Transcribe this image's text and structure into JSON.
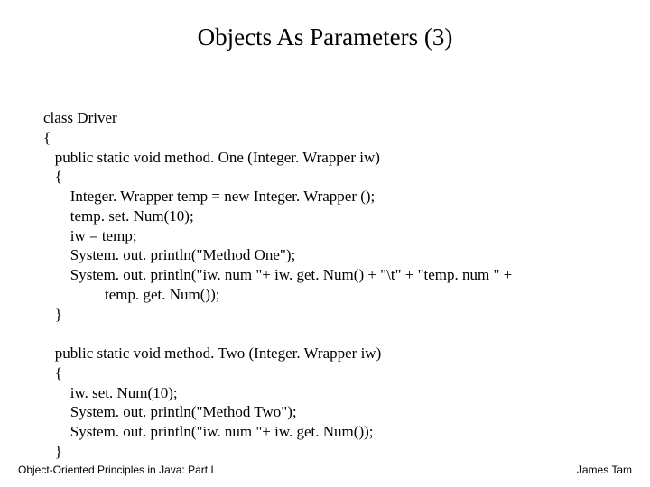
{
  "title": "Objects As Parameters (3)",
  "code": "class Driver\n{\n   public static void method. One (Integer. Wrapper iw)\n   {\n       Integer. Wrapper temp = new Integer. Wrapper ();\n       temp. set. Num(10);\n       iw = temp;\n       System. out. println(\"Method One\");\n       System. out. println(\"iw. num \"+ iw. get. Num() + \"\\t\" + \"temp. num \" +\n                temp. get. Num());\n   }\n\n   public static void method. Two (Integer. Wrapper iw)\n   {\n       iw. set. Num(10);\n       System. out. println(\"Method Two\");\n       System. out. println(\"iw. num \"+ iw. get. Num());\n   }",
  "footer_left": "Object-Oriented Principles in Java: Part I",
  "footer_right": "James Tam"
}
